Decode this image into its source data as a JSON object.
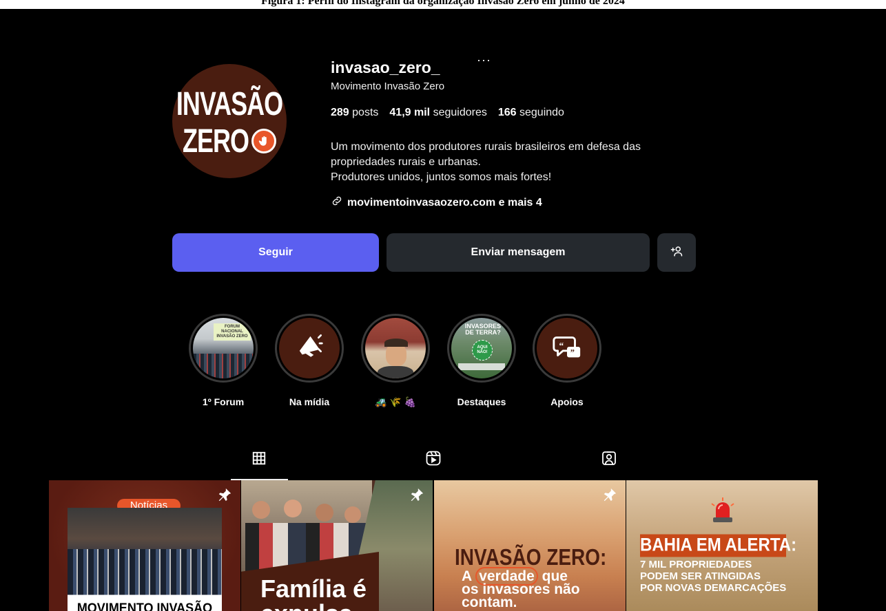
{
  "caption": "Figura 1: Perfil do Instagram da organização Invasão Zero em junho de 2024",
  "profile": {
    "avatar_text_line1": "INVASÃO",
    "avatar_text_line2": "ZERO",
    "username": "invasao_zero_",
    "more_label": "···",
    "fullname": "Movimento Invasão Zero",
    "posts_count": "289",
    "posts_label": "posts",
    "followers_count": "41,9 mil",
    "followers_label": "seguidores",
    "following_count": "166",
    "following_label": "seguindo",
    "bio_lines": [
      "Um movimento dos produtores rurais brasileiros em defesa das",
      "propriedades rurais e urbanas.",
      "Produtores unidos, juntos somos mais fortes!"
    ],
    "link": "movimentoinvasaozero.com e mais 4"
  },
  "actions": {
    "follow_label": "Seguir",
    "message_label": "Enviar mensagem",
    "suggest_icon": "add-person-icon"
  },
  "highlights": [
    {
      "label": "1º Forum",
      "thumb_text": "FORUM NACIONAL INVASÃO ZERO"
    },
    {
      "label": "Na mídia",
      "icon": "megaphone-icon"
    },
    {
      "label": "🚜 🌾 🍇",
      "thumb": "person-photo"
    },
    {
      "label": "Destaques",
      "thumb_text_1": "INVASORES DE TERRA?",
      "thumb_text_2": "AQUI NÃO!"
    },
    {
      "label": "Apoios",
      "icon": "quote-chat-icon"
    }
  ],
  "tabs": [
    "grid-icon",
    "reels-icon",
    "tagged-icon"
  ],
  "posts": [
    {
      "badge": "Notícias",
      "headline": "MOVIMENTO INVASÃO ZERO",
      "pinned": true
    },
    {
      "headline": "Família é expulsa",
      "pinned": true
    },
    {
      "headline_1": "INVASÃO ZERO:",
      "headline_2a": "A ",
      "headline_2b": "verdade",
      "headline_2c": " que",
      "headline_3": "os invasores não",
      "headline_4": "contam.",
      "pinned": true
    },
    {
      "headline_1": "BAHIA EM ALERTA:",
      "headline_2": "7 MIL PROPRIEDADES",
      "headline_3": "PODEM SER ATINGIDAS",
      "headline_4": "POR NOVAS DEMARCAÇÕES",
      "pinned": false
    }
  ],
  "colors": {
    "background": "#000000",
    "follow_button": "#5b5ff0",
    "secondary_button": "#25292e",
    "brand_brown": "#4a1d10",
    "brand_orange": "#e8562a"
  }
}
